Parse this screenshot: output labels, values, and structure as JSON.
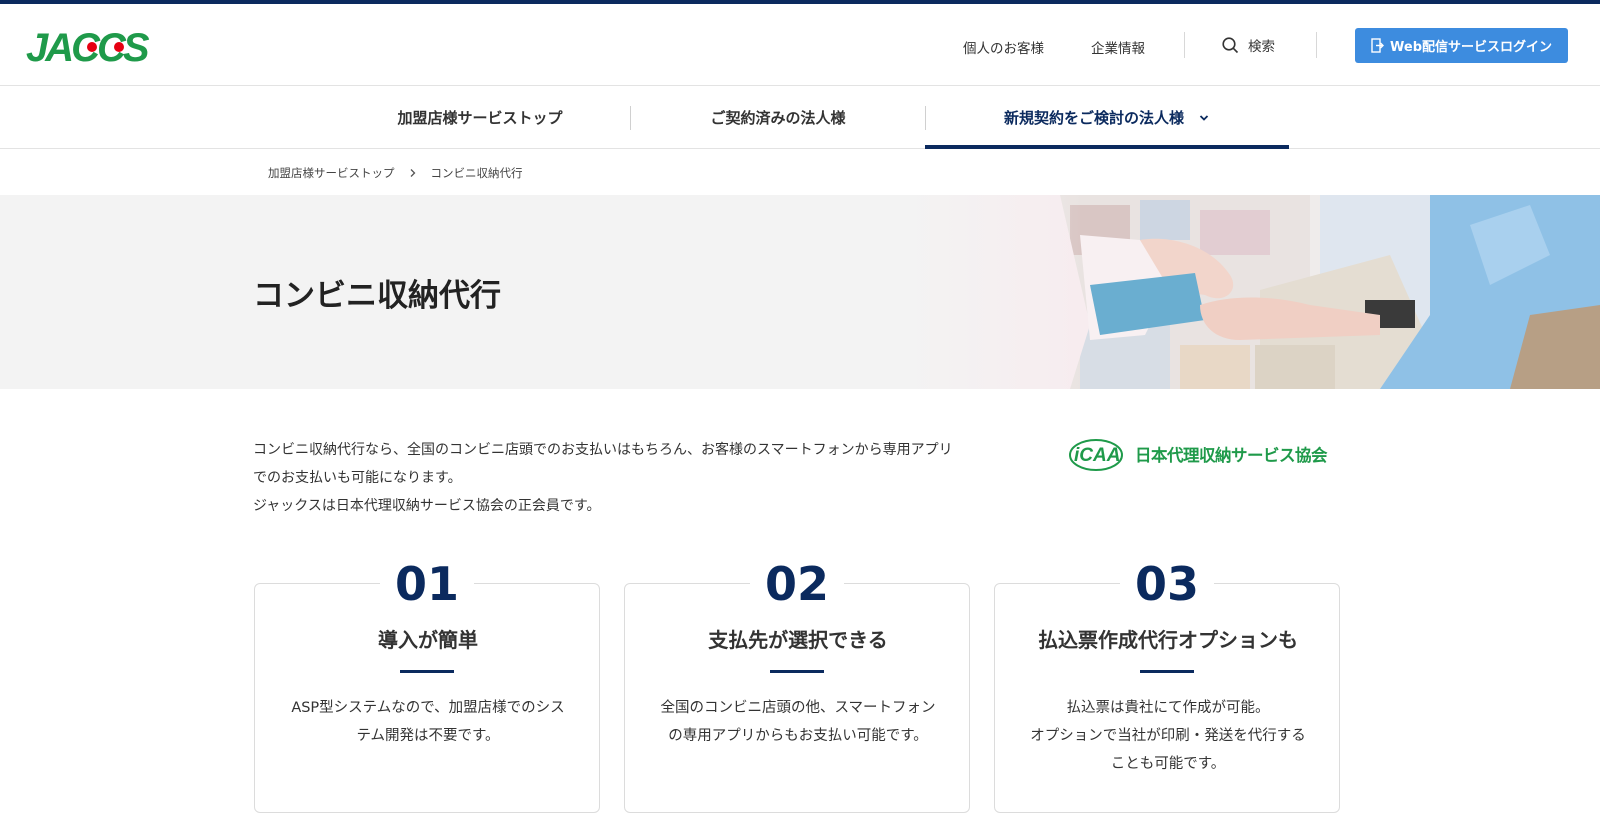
{
  "header": {
    "logo_text": "JACCS",
    "links": [
      "個人のお客様",
      "企業情報"
    ],
    "search_label": "検索",
    "login_label": "Web配信サービスログイン"
  },
  "gnav": {
    "items": [
      {
        "label": "加盟店様サービストップ"
      },
      {
        "label": "ご契約済みの法人様"
      },
      {
        "label": "新規契約をご検討の法人様"
      }
    ]
  },
  "breadcrumb": {
    "items": [
      "加盟店様サービストップ",
      "コンビニ収納代行"
    ]
  },
  "hero": {
    "title": "コンビニ収納代行"
  },
  "intro": {
    "lines": [
      "コンビニ収納代行なら、全国のコンビニ店頭でのお支払いはもちろん、お客様のスマートフォンから専用アプリ",
      "でのお支払いも可能になります。",
      "ジャックスは日本代理収納サービス協会の正会員です。"
    ],
    "partner_logo_mark": "iCAA",
    "partner_logo_text": "日本代理収納サービス協会"
  },
  "features": [
    {
      "num": "01",
      "title": "導入が簡単",
      "lines": [
        "ASP型システムなので、加盟店様でのシス",
        "テム開発は不要です。"
      ]
    },
    {
      "num": "02",
      "title": "支払先が選択できる",
      "lines": [
        "全国のコンビニ店頭の他、スマートフォン",
        "の専用アプリからもお支払い可能です。"
      ]
    },
    {
      "num": "03",
      "title": "払込票作成代行オプションも",
      "lines": [
        "払込票は貴社にて作成が可能。",
        "オプションで当社が印刷・発送を代行する",
        "ことも可能です。"
      ]
    }
  ],
  "colors": {
    "brand_navy": "#0b2a5e",
    "brand_green": "#1f9a4a",
    "login_blue": "#3d8cdf",
    "logo_red": "#e60012"
  }
}
